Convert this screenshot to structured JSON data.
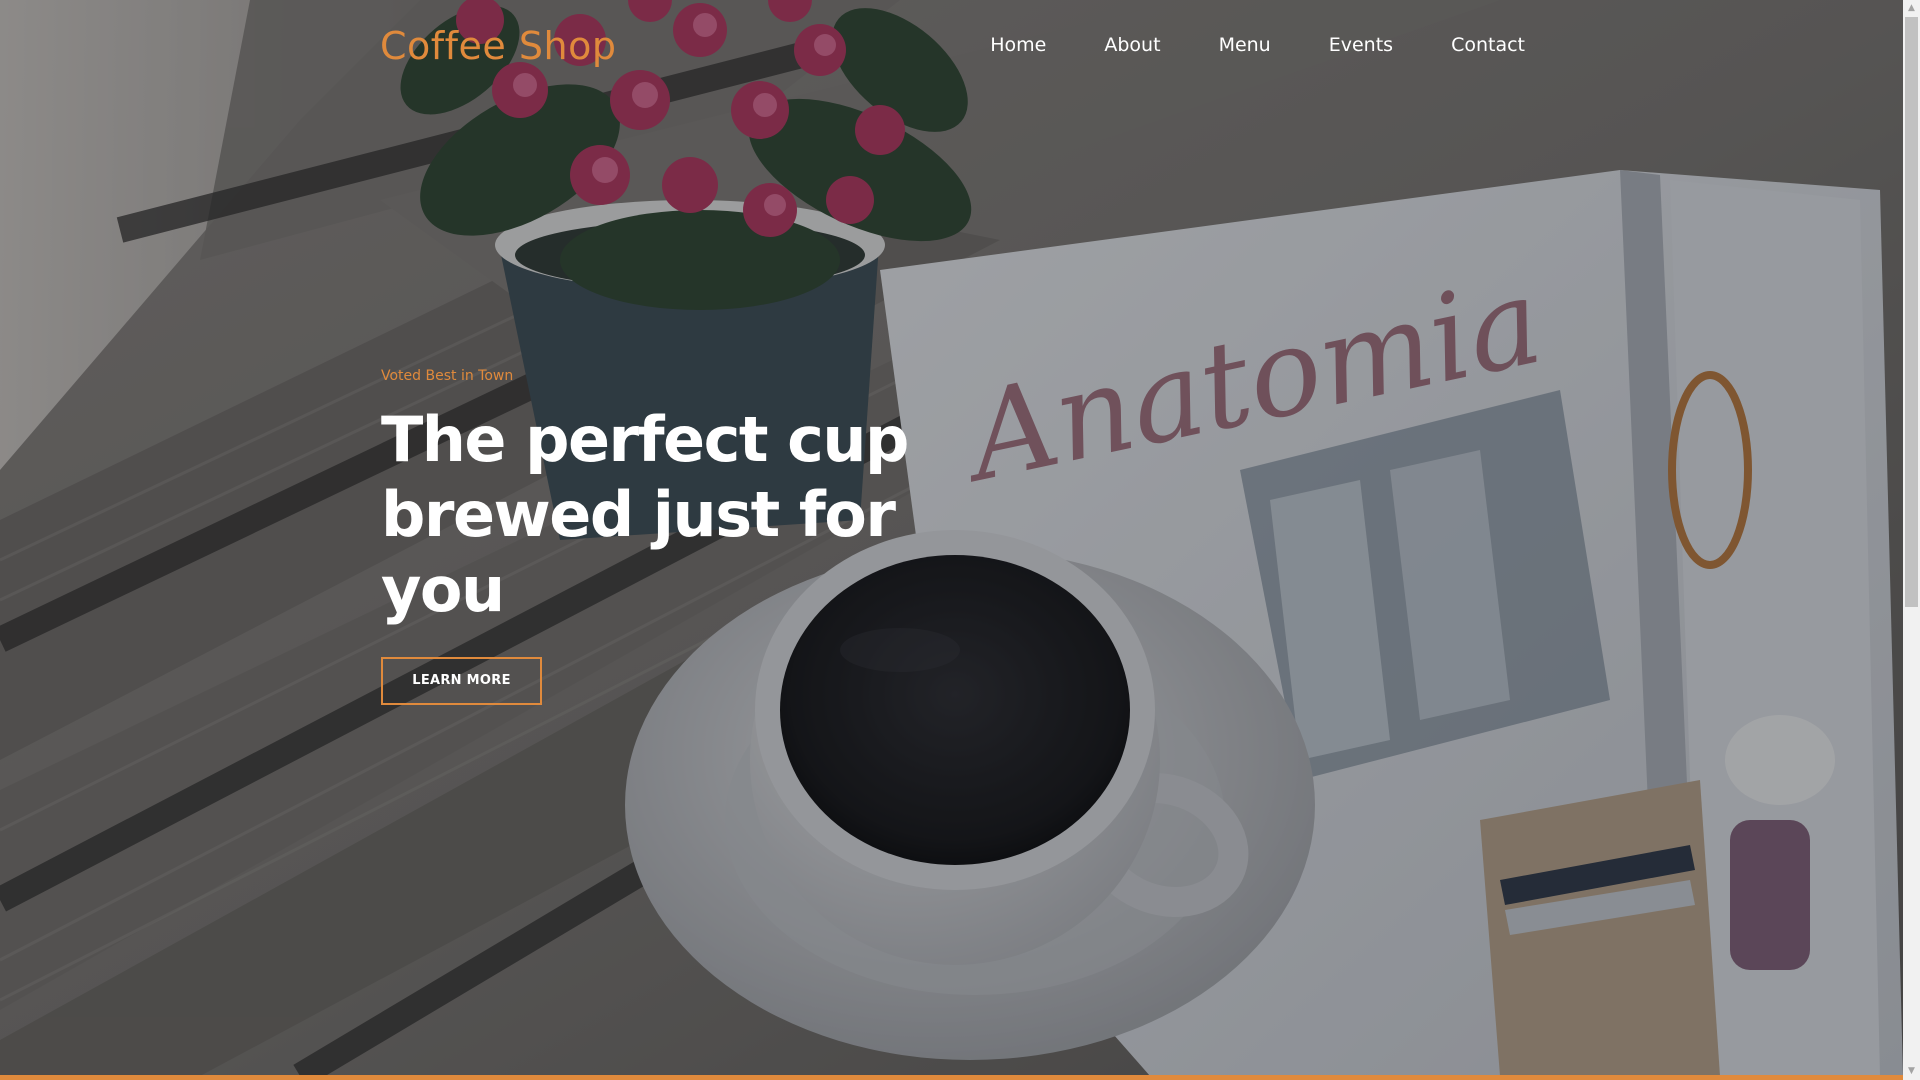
{
  "brand": {
    "name": "Coffee Shop",
    "color": "#e08a3c"
  },
  "nav": {
    "items": [
      {
        "label": "Home"
      },
      {
        "label": "About"
      },
      {
        "label": "Menu"
      },
      {
        "label": "Events"
      },
      {
        "label": "Contact"
      }
    ]
  },
  "hero": {
    "eyebrow": "Voted Best in Town",
    "headline": "The perfect cup brewed just for you",
    "cta_label": "LEARN MORE",
    "background": "photo-coffee-cup-flowers-magazine-on-wooden-table"
  },
  "theme": {
    "accent": "#e08a3c",
    "text": "#ffffff"
  },
  "scrollbar": {
    "up_icon": "chevron-up-icon",
    "down_icon": "chevron-down-icon"
  }
}
